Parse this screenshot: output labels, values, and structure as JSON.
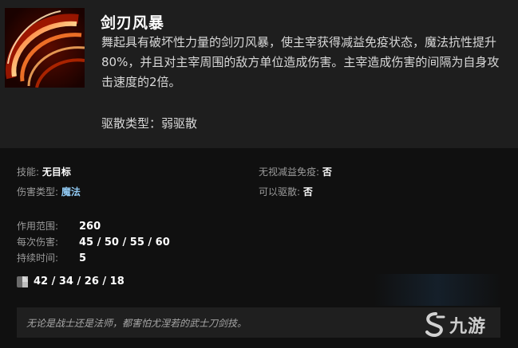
{
  "ability": {
    "title": "剑刃风暴",
    "icon": "blade-fury-icon",
    "description": "舞起具有破坏性力量的剑刃风暴，使主宰获得减益免疫状态，魔法抗性提升80%，并且对主宰周围的敌方单位造成伤害。主宰造成伤害的间隔为自身攻击速度的2倍。",
    "dispel": "驱散类型：弱驱散"
  },
  "attributes": {
    "ability_label": "技能:",
    "ability_value": "无目标",
    "damage_type_label": "伤害类型:",
    "damage_type_value": "魔法",
    "pierce_label": "无视减益免疫:",
    "pierce_value": "否",
    "dispellable_label": "可以驱散:",
    "dispellable_value": "否"
  },
  "stats": [
    {
      "label": "作用范围:",
      "value": "260"
    },
    {
      "label": "每次伤害:",
      "value": "45 / 50 / 55 / 60"
    },
    {
      "label": "持续时间:",
      "value": "5"
    }
  ],
  "cooldown": {
    "icon": "cooldown-icon",
    "value": "42 / 34 / 26 / 18"
  },
  "lore": "无论是战士还是法师，都害怕尤涅若的武士刀剑技。",
  "watermark": {
    "icon": "jiuyou-logo-icon",
    "text": "九游"
  },
  "colors": {
    "header_bg": "#1e1e1e",
    "body_bg": "#101010",
    "magic_blue": "#8fc7f0"
  }
}
